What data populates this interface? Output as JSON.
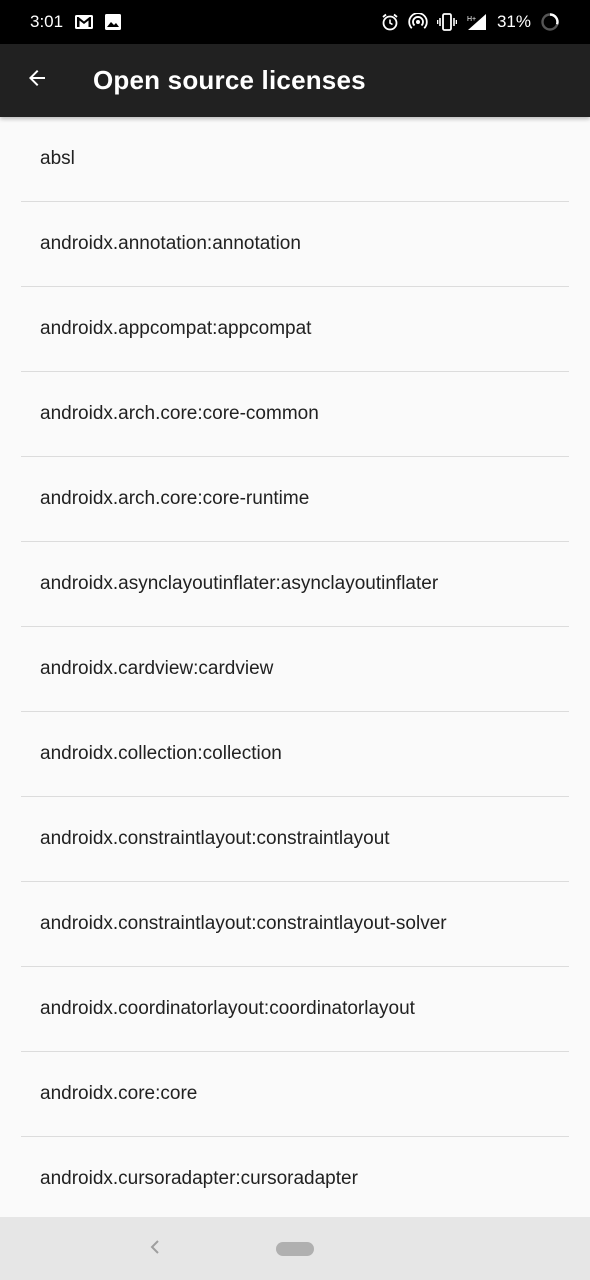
{
  "status_bar": {
    "time": "3:01",
    "battery_percent": "31%",
    "left_icons": [
      "gmail-icon",
      "image-icon"
    ],
    "right_icons": [
      "alarm-icon",
      "hotspot-icon",
      "vibrate-icon",
      "signal-icon",
      "battery-icon"
    ]
  },
  "app_bar": {
    "title": "Open source licenses",
    "back_icon": "arrow-back-icon"
  },
  "licenses": [
    "absl",
    "androidx.annotation:annotation",
    "androidx.appcompat:appcompat",
    "androidx.arch.core:core-common",
    "androidx.arch.core:core-runtime",
    "androidx.asynclayoutinflater:asynclayoutinflater",
    "androidx.cardview:cardview",
    "androidx.collection:collection",
    "androidx.constraintlayout:constraintlayout",
    "androidx.constraintlayout:constraintlayout-solver",
    "androidx.coordinatorlayout:coordinatorlayout",
    "androidx.core:core",
    "androidx.cursoradapter:cursoradapter"
  ],
  "colors": {
    "status_bar_bg": "#000000",
    "app_bar_bg": "#212121",
    "list_bg": "#fafafa",
    "divider": "#dcdcdc",
    "nav_bar_bg": "#e6e6e6"
  }
}
